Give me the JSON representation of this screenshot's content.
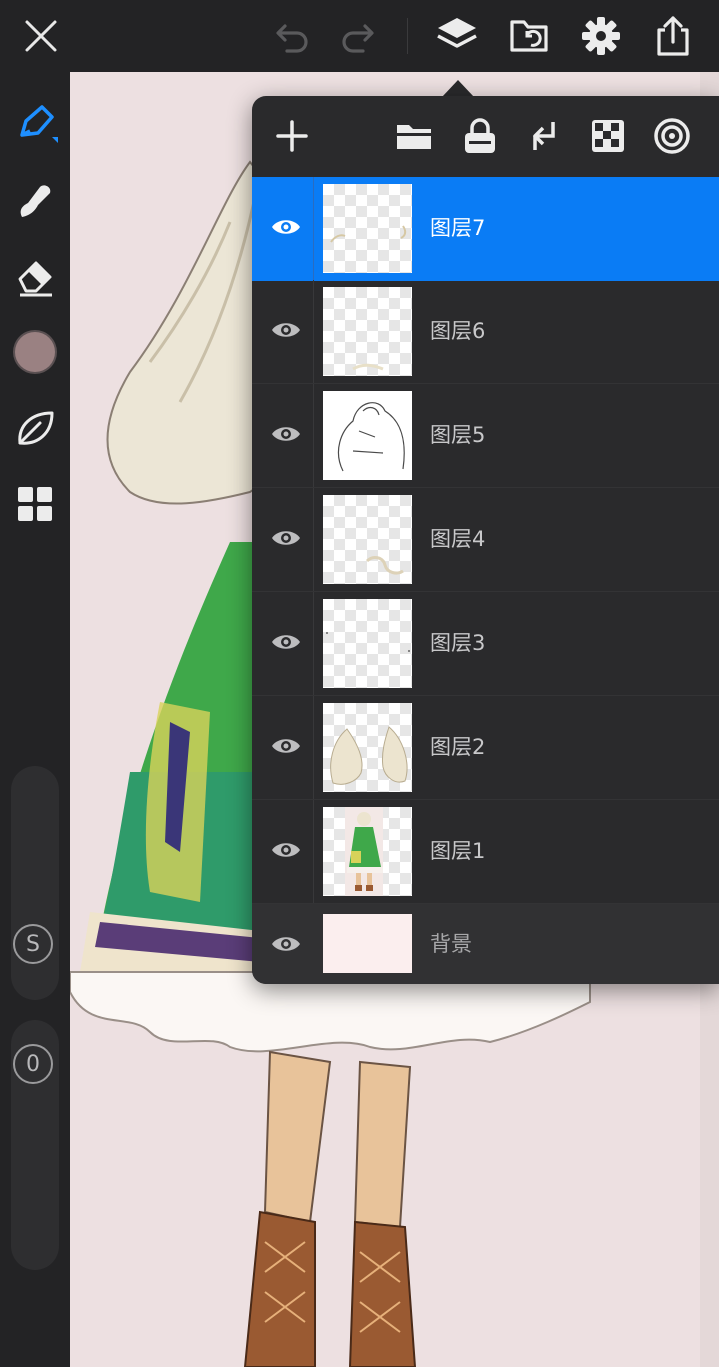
{
  "topbar": {
    "icons": [
      "close-icon",
      "undo-icon",
      "redo-icon",
      "layers-icon",
      "gallery-import-icon",
      "settings-gear-icon",
      "share-export-icon"
    ]
  },
  "left_tools": {
    "icons": [
      "brush-pen-icon",
      "smudge-icon",
      "eraser-icon",
      "color-swatch",
      "leaf-stabilizer-icon",
      "grid-tools-icon"
    ],
    "current_color": "#9a8182",
    "size_slider_label": "S",
    "opacity_slider_label": "0"
  },
  "layers_panel": {
    "toolbar_icons": [
      "add-layer-icon",
      "folder-icon",
      "lock-icon",
      "merge-down-icon",
      "alpha-lock-icon",
      "target-icon"
    ],
    "selected_color": "#0a7cf5",
    "layers": [
      {
        "name": "图层7",
        "selected": true
      },
      {
        "name": "图层6",
        "selected": false
      },
      {
        "name": "图层5",
        "selected": false
      },
      {
        "name": "图层4",
        "selected": false
      },
      {
        "name": "图层3",
        "selected": false
      },
      {
        "name": "图层2",
        "selected": false
      },
      {
        "name": "图层1",
        "selected": false
      }
    ],
    "background_layer": {
      "name": "背景",
      "color": "#fbeeee"
    }
  },
  "canvas": {
    "background": "#ede0e1"
  }
}
